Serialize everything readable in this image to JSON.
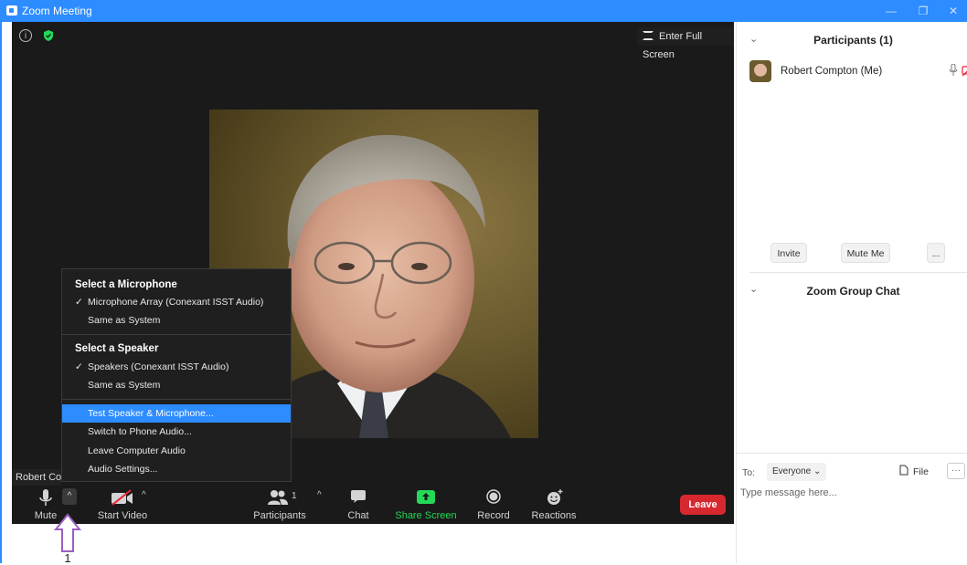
{
  "window": {
    "title": "Zoom Meeting",
    "minimize": "—",
    "restore": "❐",
    "close": "✕"
  },
  "video": {
    "fullscreen_label": "Enter Full Screen",
    "name_tag": "Robert Compton",
    "security_color": "#23d959"
  },
  "audio_menu": {
    "mic_heading": "Select a Microphone",
    "mic_options": [
      {
        "label": "Microphone Array (Conexant ISST Audio)",
        "checked": true
      },
      {
        "label": "Same as System",
        "checked": false
      }
    ],
    "speaker_heading": "Select a Speaker",
    "speaker_options": [
      {
        "label": "Speakers (Conexant ISST Audio)",
        "checked": true
      },
      {
        "label": "Same as System",
        "checked": false
      }
    ],
    "actions": [
      {
        "label": "Test Speaker & Microphone...",
        "highlighted": true
      },
      {
        "label": "Switch to Phone Audio..."
      },
      {
        "label": "Leave Computer Audio"
      },
      {
        "label": "Audio Settings..."
      }
    ],
    "check_glyph": "✓"
  },
  "toolbar": {
    "mute": "Mute",
    "start_video": "Start Video",
    "participants": "Participants",
    "participants_count": "1",
    "chat": "Chat",
    "share_screen": "Share Screen",
    "record": "Record",
    "reactions": "Reactions",
    "leave": "Leave",
    "caret_up": "^",
    "share_color": "#23d959",
    "leave_color": "#d7282f"
  },
  "annotation": {
    "number": "1"
  },
  "participants_panel": {
    "title": "Participants (1)",
    "participants": [
      {
        "name": "Robert Compton (Me)"
      }
    ],
    "invite": "Invite",
    "mute_me": "Mute Me",
    "more": "...",
    "chevron": "⌄"
  },
  "chat_panel": {
    "title": "Zoom Group Chat",
    "to_label": "To:",
    "recipient": "Everyone ⌄",
    "file": "File",
    "more": "···",
    "placeholder": "Type message here..."
  }
}
